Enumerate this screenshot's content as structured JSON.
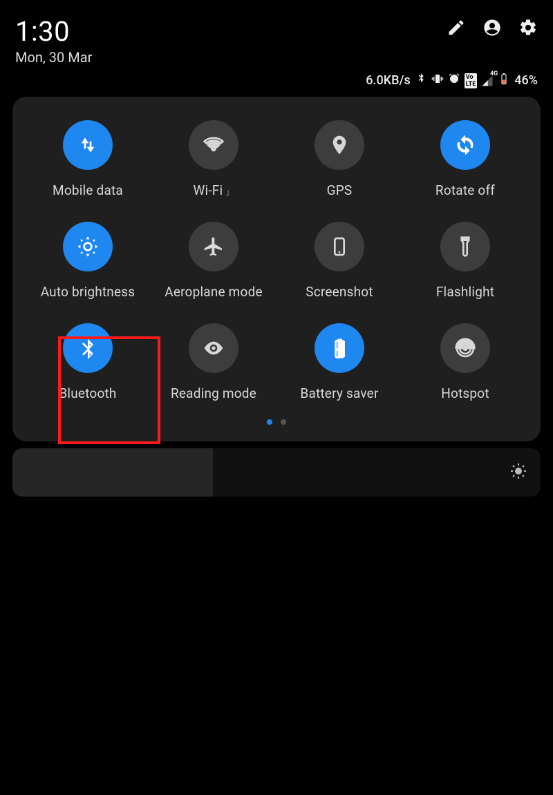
{
  "time": "1:30",
  "date": "Mon, 30 Mar",
  "status": {
    "net_speed": "6.0KB/s",
    "battery_pct": "46%",
    "signal_label": "4G"
  },
  "tiles": [
    {
      "id": "mobile-data",
      "label": "Mobile data",
      "active": true,
      "icon": "arrows-updown"
    },
    {
      "id": "wifi",
      "label": "Wi-Fi",
      "active": false,
      "icon": "wifi",
      "sublabel": "」"
    },
    {
      "id": "gps",
      "label": "GPS",
      "active": false,
      "icon": "location"
    },
    {
      "id": "rotate",
      "label": "Rotate off",
      "active": true,
      "icon": "rotate"
    },
    {
      "id": "auto-brightness",
      "label": "Auto brightness",
      "active": true,
      "icon": "brightness"
    },
    {
      "id": "airplane",
      "label": "Aeroplane mode",
      "active": false,
      "icon": "airplane"
    },
    {
      "id": "screenshot",
      "label": "Screenshot",
      "active": false,
      "icon": "phone"
    },
    {
      "id": "flashlight",
      "label": "Flashlight",
      "active": false,
      "icon": "flashlight"
    },
    {
      "id": "bluetooth",
      "label": "Bluetooth",
      "active": true,
      "icon": "bluetooth",
      "highlighted": true
    },
    {
      "id": "reading",
      "label": "Reading mode",
      "active": false,
      "icon": "eye"
    },
    {
      "id": "battery-saver",
      "label": "Battery saver",
      "active": true,
      "icon": "battery-plus"
    },
    {
      "id": "hotspot",
      "label": "Hotspot",
      "active": false,
      "icon": "hotspot"
    }
  ],
  "page_indicator": {
    "count": 2,
    "active": 0
  },
  "brightness_slider": {
    "percent": 38
  }
}
